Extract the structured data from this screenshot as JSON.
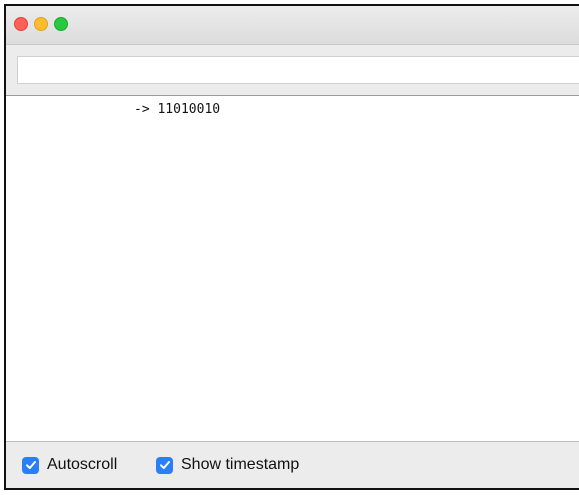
{
  "window": {
    "controls": {
      "close": "traffic-close",
      "minimize": "traffic-minimize",
      "maximize": "traffic-maximize"
    }
  },
  "input": {
    "value": "",
    "placeholder": ""
  },
  "output": {
    "lines": [
      {
        "timestamp": "",
        "text": "-> 11010010"
      }
    ]
  },
  "footer": {
    "autoscroll": {
      "label": "Autoscroll",
      "checked": true
    },
    "show_timestamp": {
      "label": "Show timestamp",
      "checked": true
    }
  },
  "colors": {
    "close": "#fe5f57",
    "minimize": "#febc2e",
    "maximize": "#28c840",
    "checkbox_accent": "#2a7ff7"
  }
}
